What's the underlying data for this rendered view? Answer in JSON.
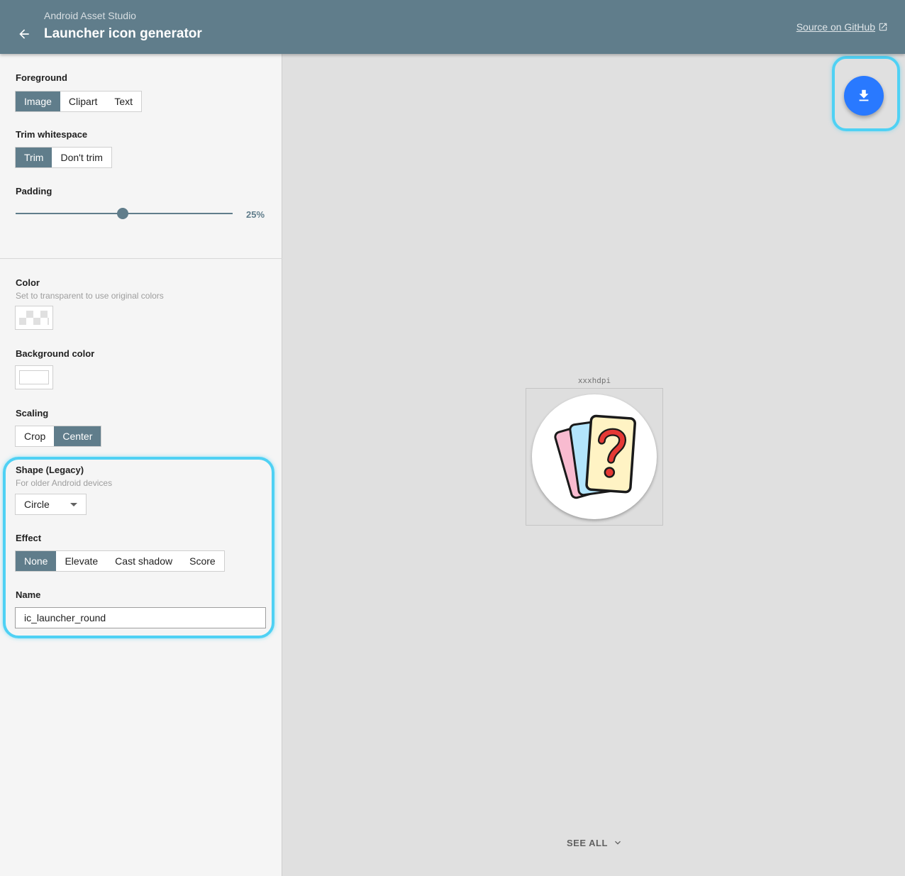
{
  "header": {
    "app_name": "Android Asset Studio",
    "title": "Launcher icon generator",
    "github_link": "Source on GitHub"
  },
  "sidebar": {
    "foreground": {
      "label": "Foreground",
      "options": [
        "Image",
        "Clipart",
        "Text"
      ],
      "selected": "Image"
    },
    "trim": {
      "label": "Trim whitespace",
      "options": [
        "Trim",
        "Don't trim"
      ],
      "selected": "Trim"
    },
    "padding": {
      "label": "Padding",
      "value_text": "25%",
      "value": 25,
      "max": 50
    },
    "color": {
      "label": "Color",
      "hint": "Set to transparent to use original colors",
      "value": "transparent"
    },
    "background_color": {
      "label": "Background color",
      "value": "#ffffff"
    },
    "scaling": {
      "label": "Scaling",
      "options": [
        "Crop",
        "Center"
      ],
      "selected": "Center"
    },
    "shape": {
      "label": "Shape (Legacy)",
      "hint": "For older Android devices",
      "selected": "Circle"
    },
    "effect": {
      "label": "Effect",
      "options": [
        "None",
        "Elevate",
        "Cast shadow",
        "Score"
      ],
      "selected": "None"
    },
    "name": {
      "label": "Name",
      "value": "ic_launcher_round"
    }
  },
  "preview": {
    "density": "xxxhdpi",
    "see_all": "SEE ALL"
  },
  "colors": {
    "header_bg": "#607d8b",
    "accent": "#607d8b",
    "fab": "#2979ff",
    "highlight": "#4fd1f4"
  },
  "icons": {
    "back": "arrow-left-icon",
    "external": "external-link-icon",
    "download": "download-icon",
    "dropdown": "chevron-down-icon"
  }
}
